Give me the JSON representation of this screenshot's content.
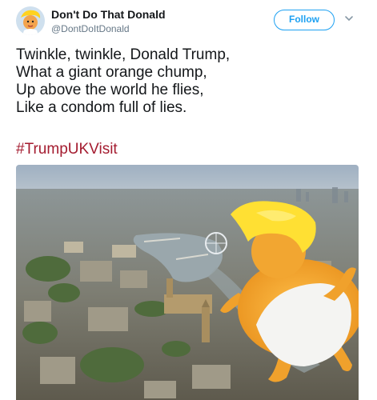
{
  "user": {
    "display_name": "Don't Do That Donald",
    "handle": "@DontDoItDonald"
  },
  "follow_button": {
    "label": "Follow"
  },
  "tweet": {
    "lines": [
      "Twinkle, twinkle, Donald Trump,",
      "What a giant orange chump,",
      "Up above the world he flies,",
      "Like a condom full of lies."
    ],
    "hashtag": "#TrumpUKVisit"
  },
  "colors": {
    "accent": "#1da1f2",
    "hashtag": "#a41c30",
    "balloon_skin": "#f5a623",
    "balloon_hair": "#ffe033"
  },
  "icons": {
    "avatar": "cartoon-trump-avatar",
    "more": "chevron-down-icon"
  },
  "media": {
    "description": "aerial London skyline with inflatable baby Trump balloon"
  }
}
